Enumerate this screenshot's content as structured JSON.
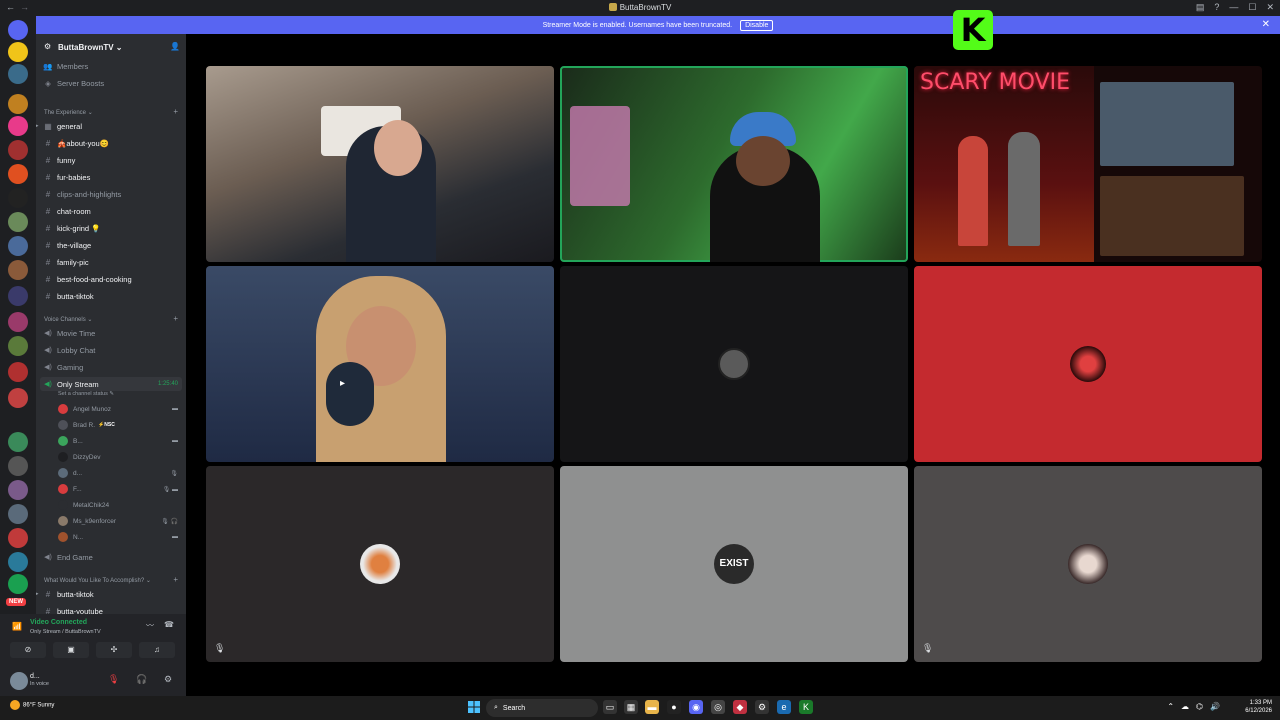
{
  "titlebar": {
    "title": "ButtaBrownTV",
    "back": "←",
    "forward": "→"
  },
  "banner": {
    "message": "Streamer Mode is enabled. Usernames have been truncated.",
    "disable_label": "Disable",
    "close": "✕"
  },
  "server": {
    "name": "ButtaBrownTV ⌄",
    "members_label": "Members",
    "boosts_label": "Server Boosts"
  },
  "categories": {
    "experience": "The Experience ⌄",
    "voice": "Voice Channels ⌄",
    "accomplish": "What Would You Like To Accomplish? ⌄"
  },
  "text_channels": [
    "general",
    "🎪about-you😊",
    "funny",
    "fur-babies",
    "clips-and-highlights",
    "chat-room",
    "kick-grind 💡",
    "the-village",
    "family-pic",
    "best-food-and-cooking",
    "butta-tiktok"
  ],
  "voice_channels": [
    "Movie Time",
    "Lobby Chat",
    "Gaming"
  ],
  "active_voice": {
    "name": "Only Stream",
    "timer": "1:25:40",
    "status_hint": "Set a channel status ✎"
  },
  "voice_members": [
    {
      "name": "Angel Munoz",
      "tag": "",
      "color": "#d83c3e",
      "indicator": "▬"
    },
    {
      "name": "Brad R.",
      "tag": "⚡NSC",
      "color": "#4e5058",
      "indicator": ""
    },
    {
      "name": "B...",
      "tag": "",
      "color": "#3ba55c",
      "indicator": "▬"
    },
    {
      "name": "DizzyDev",
      "tag": "",
      "color": "#1e1f22",
      "indicator": ""
    },
    {
      "name": "d...",
      "tag": "",
      "color": "#5c6b7a",
      "indicator": "🎙"
    },
    {
      "name": "F...",
      "tag": "",
      "color": "#d83c3e",
      "indicator": "🎙 ▬"
    },
    {
      "name": "MetalChik24",
      "tag": "",
      "color": "#2b2d31",
      "indicator": ""
    },
    {
      "name": "Ms_k9enforcer",
      "tag": "",
      "color": "#8a7a6a",
      "indicator": "🎙 🎧"
    },
    {
      "name": "N...",
      "tag": "",
      "color": "#a0522d",
      "indicator": "▬"
    }
  ],
  "end_game": "End Game",
  "bottom_channels": [
    "butta-tiktok",
    "butta-youtube"
  ],
  "voice_panel": {
    "title": "Video Connected",
    "subtitle": "Only Stream / ButtaBrownTV"
  },
  "user_panel": {
    "name": "d...",
    "status": "In voice"
  },
  "tiles": {
    "scary_title": "SCARY MOVIE",
    "exist_label": "EXIST"
  },
  "taskbar": {
    "weather_temp": "86°F",
    "weather_desc": "Sunny",
    "search_label": "Search",
    "time": "1:33 PM",
    "date": "6/12/2026"
  },
  "colors": {
    "accent": "#5865f2",
    "kick": "#53fc18",
    "online": "#23a55a",
    "red_tile": "#c42a2f"
  }
}
